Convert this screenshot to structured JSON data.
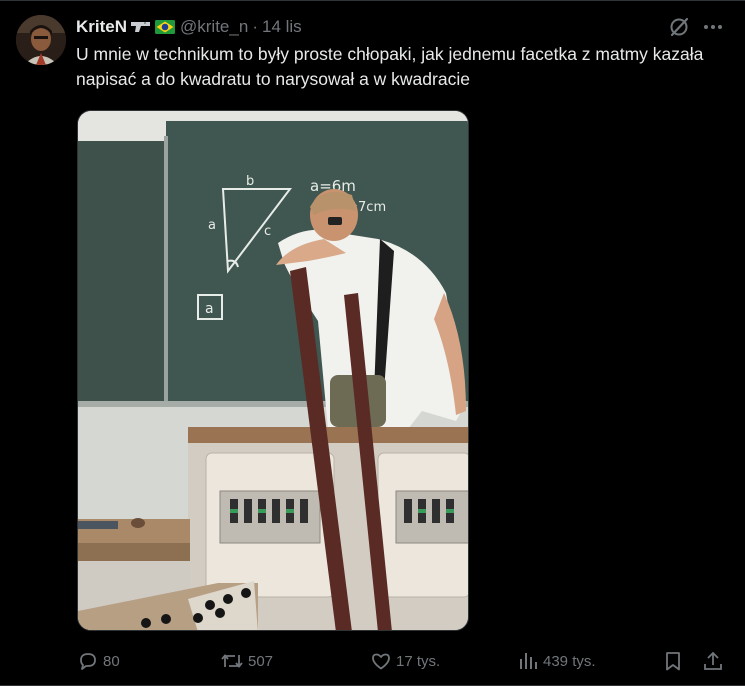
{
  "author": {
    "name": "KriteN",
    "handle": "@krite_n",
    "separator": "·",
    "timestamp": "14 lis"
  },
  "post": {
    "text": "U mnie w technikum to były proste chłopaki, jak jednemu facetka z matmy kazała napisać a do kwadratu to narysował a w kwadracie"
  },
  "media": {
    "board": {
      "triangle_label_top": "b",
      "triangle_label_left": "a",
      "triangle_label_hyp": "c",
      "note_1": "a=6m",
      "note_2": "c=7cm",
      "boxed_letter": "a"
    }
  },
  "actions": {
    "replies": "80",
    "reposts": "507",
    "likes": "17 tys.",
    "views": "439 tys."
  },
  "icons": [
    "avatar",
    "pistol-emoji-icon",
    "brazil-flag-icon",
    "grok-icon",
    "more-icon",
    "reply-icon",
    "repost-icon",
    "like-icon",
    "views-icon",
    "bookmark-icon",
    "share-icon"
  ],
  "colors": {
    "background": "#000000",
    "text": "#e7e9ea",
    "secondary": "#71767b",
    "border": "#2f3336"
  }
}
